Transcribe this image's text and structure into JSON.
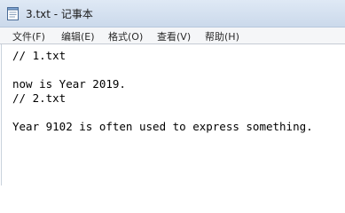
{
  "window": {
    "title": "3.txt - 记事本",
    "icon": "notepad-icon"
  },
  "menu": {
    "items": [
      "文件(F)",
      "编辑(E)",
      "格式(O)",
      "查看(V)",
      "帮助(H)"
    ]
  },
  "editor": {
    "lines": [
      "// 1.txt",
      "",
      "now is Year 2019.",
      "// 2.txt",
      "",
      "Year 9102 is often used to express something."
    ]
  }
}
